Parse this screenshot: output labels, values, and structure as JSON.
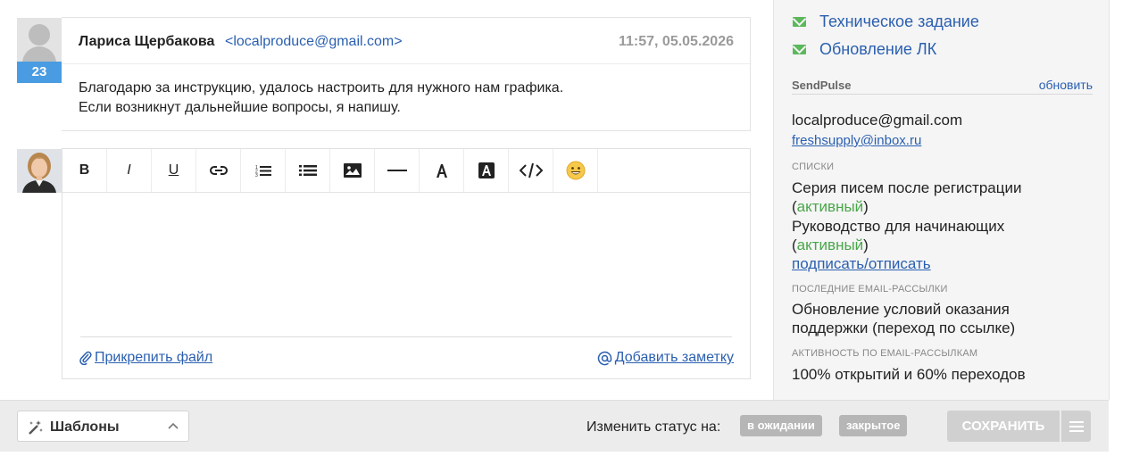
{
  "message": {
    "author": "Лариса Щербакова",
    "email": "<localproduce@gmail.com>",
    "time": "11:57, 05.05.2026",
    "count": "23",
    "body_line1": "Благодарю за инструкцию, удалось настроить для нужного нам графика.",
    "body_line2": "Если возникнут дальнейшие вопросы, я напишу."
  },
  "toolbar": {
    "bold": "B",
    "italic": "I",
    "underline": "U",
    "icons": [
      "link-icon",
      "ordered-list-icon",
      "bullet-list-icon",
      "image-icon",
      "horizontal-rule-icon",
      "text-color-icon",
      "background-color-icon",
      "code-icon",
      "emoji-icon"
    ]
  },
  "editor": {
    "attach_label": "Прикрепить файл",
    "add_note_label": "Добавить заметку"
  },
  "sidebar": {
    "tasks": [
      {
        "label": "Техническое задание"
      },
      {
        "label": "Обновление ЛК"
      }
    ],
    "sendpulse": {
      "title": "SendPulse",
      "refresh": "обновить",
      "email": "localproduce@gmail.com",
      "alt_email": "freshsupply@inbox.ru",
      "lists_label": "СПИСКИ",
      "lists": [
        {
          "name": "Серия писем после регистрации",
          "status": "активный"
        },
        {
          "name": "Руководство для начинающих",
          "status": "активный"
        }
      ],
      "subscribe_link": "подписать/отписать",
      "campaigns_label": "ПОСЛЕДНИЕ EMAIL-РАССЫЛКИ",
      "campaign_line1": "Обновление условий оказания",
      "campaign_line2": "поддержки (переход по ссылке)",
      "activity_label": "АКТИВНОСТЬ ПО EMAIL-РАССЫЛКАМ",
      "activity": "100% открытий и 60% переходов"
    }
  },
  "bottom": {
    "templates_label": "Шаблоны",
    "status_label": "Изменить статус на:",
    "status_pending": "в ожидании",
    "status_closed": "закрытое",
    "save_label": "СОХРАНИТЬ"
  },
  "colors": {
    "link": "#2a5fb0",
    "badge": "#4a9ce2",
    "active": "#4aa64a",
    "task_icon": "#5cb85c"
  }
}
